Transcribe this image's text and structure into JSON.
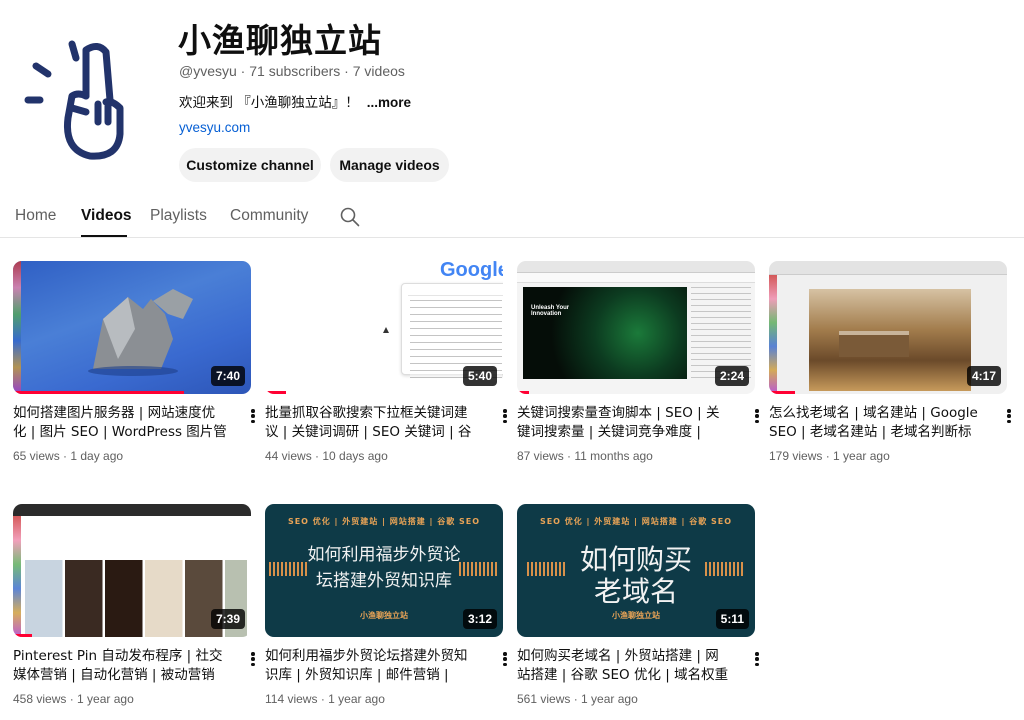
{
  "channel": {
    "name": "小渔聊独立站",
    "handle": "@yvesyu",
    "subscribers": "71 subscribers",
    "videos_count": "7 videos",
    "separator": " · ",
    "description": "欢迎来到 『小渔聊独立站』！",
    "more_label": "...more",
    "link": "yvesyu.com"
  },
  "buttons": {
    "customize": "Customize channel",
    "manage": "Manage videos"
  },
  "tabs": [
    {
      "label": "Home",
      "active": false
    },
    {
      "label": "Videos",
      "active": true
    },
    {
      "label": "Playlists",
      "active": false
    },
    {
      "label": "Community",
      "active": false
    }
  ],
  "icons": {
    "avatar": "raised-finger-logo",
    "search": "search-icon",
    "menu": "more-vert-icon"
  },
  "colors": {
    "accent_blue": "#065fd4",
    "progress_red": "#ff0033",
    "logo_navy": "#22336b",
    "teal_bg": "#0e3a47",
    "orange": "#e8a356"
  },
  "videos": [
    {
      "title": "如何搭建图片服务器 | 网站速度优化 | 图片 SEO | WordPress 图片管理 |...",
      "views": "65 views",
      "age": "1 day ago",
      "duration": "7:40",
      "watched": 0.72
    },
    {
      "title": "批量抓取谷歌搜索下拉框关键词建议 | 关键词调研 | SEO 关键词 | 谷歌下...",
      "views": "44 views",
      "age": "10 days ago",
      "duration": "5:40",
      "watched": 0.09
    },
    {
      "title": "关键词搜索量查询脚本 | SEO | 关键词搜索量 | 关键词竞争难度 | Jupyte...",
      "views": "87 views",
      "age": "11 months ago",
      "duration": "2:24",
      "watched": 0.05
    },
    {
      "title": "怎么找老域名 | 域名建站 | Google SEO | 老域名建站 | 老域名判断标准",
      "views": "179 views",
      "age": "1 year ago",
      "duration": "4:17",
      "watched": 0.11
    },
    {
      "title": "Pinterest Pin 自动发布程序 | 社交媒体营销 | 自动化营销 | 被动营销 |...",
      "views": "458 views",
      "age": "1 year ago",
      "duration": "7:39",
      "watched": 0.08
    },
    {
      "title": "如何利用福步外贸论坛搭建外贸知识库 | 外贸知识库 | 邮件营销 | Cold...",
      "views": "114 views",
      "age": "1 year ago",
      "duration": "3:12",
      "watched": 0,
      "thumb_tag": "SEO 优化 | 外贸建站 | 网站搭建 | 谷歌 SEO",
      "thumb_text": [
        "如何利用福步外贸论",
        "坛搭建外贸知识库"
      ],
      "thumb_brand": "小渔聊独立站"
    },
    {
      "title": "如何购买老域名 | 外贸站搭建 | 网站搭建 | 谷歌 SEO 优化 | 域名权重",
      "views": "561 views",
      "age": "1 year ago",
      "duration": "5:11",
      "watched": 0,
      "thumb_tag": "SEO 优化 | 外贸建站 | 网站搭建 | 谷歌 SEO",
      "thumb_text": [
        "如何购买",
        "老域名"
      ],
      "thumb_brand": "小渔聊独立站"
    }
  ]
}
